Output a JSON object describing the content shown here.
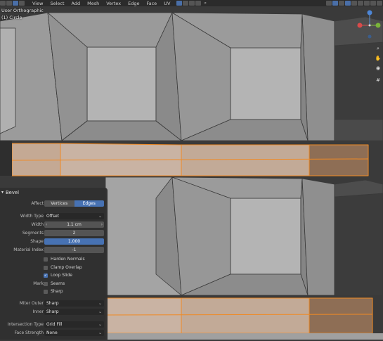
{
  "header": {
    "menus": [
      "View",
      "Select",
      "Add",
      "Mesh",
      "Vertex",
      "Edge",
      "Face",
      "UV"
    ]
  },
  "viewport": {
    "view_name": "User Orthographic",
    "object_name": "(1) Circle"
  },
  "colors": {
    "face": "#a8a8a8",
    "face_dark": "#8c8c8c",
    "inset": "#b3b3b3",
    "gap": "#2e2e2e",
    "selected": "#f08a24",
    "selected_face": "#c4a994",
    "panel_bg": "#303030",
    "accent": "#4772b3"
  },
  "panel": {
    "title": "Bevel",
    "affect": {
      "label": "Affect",
      "options": [
        "Vertices",
        "Edges"
      ],
      "selected": "Edges"
    },
    "width_type": {
      "label": "Width Type",
      "value": "Offset"
    },
    "width": {
      "label": "Width",
      "value": "1.1 cm"
    },
    "segments": {
      "label": "Segments",
      "value": "2"
    },
    "shape": {
      "label": "Shape",
      "value": "1.000"
    },
    "material_index": {
      "label": "Material Index",
      "value": "-1"
    },
    "harden_normals": {
      "label": "Harden Normals",
      "checked": false
    },
    "clamp_overlap": {
      "label": "Clamp Overlap",
      "checked": false
    },
    "loop_slide": {
      "label": "Loop Slide",
      "checked": true
    },
    "mark": {
      "label": "Mark",
      "seams": {
        "label": "Seams",
        "checked": false
      },
      "sharp": {
        "label": "Sharp",
        "checked": false
      }
    },
    "miter_outer": {
      "label": "Miter Outer",
      "value": "Sharp"
    },
    "inner": {
      "label": "Inner",
      "value": "Sharp"
    },
    "intersection_type": {
      "label": "Intersection Type",
      "value": "Grid Fill"
    },
    "face_strength": {
      "label": "Face Strength",
      "value": "None"
    }
  }
}
